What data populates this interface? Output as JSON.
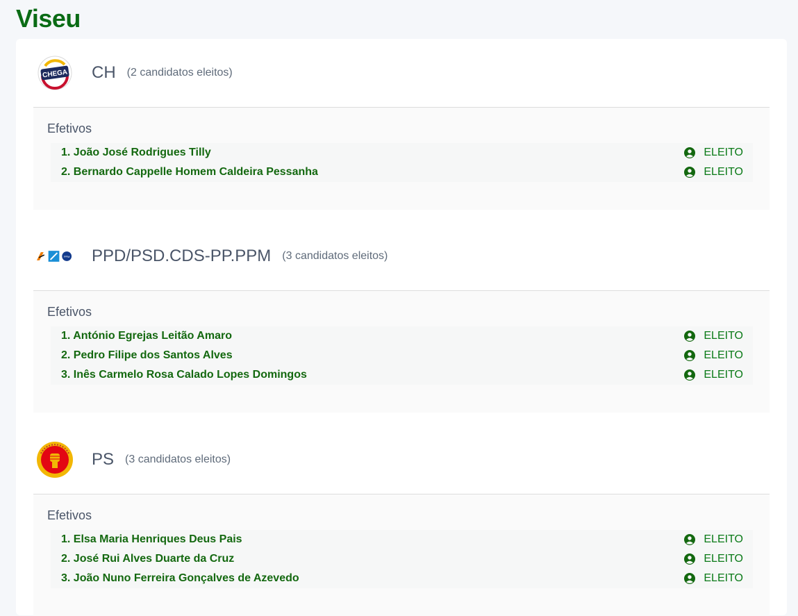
{
  "page_title": "Viseu",
  "parties": [
    {
      "logo_icon": "chega-logo-icon",
      "name": "CH",
      "count": "(2 candidatos eleitos)",
      "section_title": "Efetivos",
      "candidates": [
        {
          "name": "1. João José Rodrigues Tilly",
          "status": "ELEITO"
        },
        {
          "name": "2. Bernardo Cappelle Homem Caldeira Pessanha",
          "status": "ELEITO"
        }
      ]
    },
    {
      "logo_icon": "coalition-logos-icon",
      "name": "PPD/PSD.CDS-PP.PPM",
      "count": "(3 candidatos eleitos)",
      "section_title": "Efetivos",
      "candidates": [
        {
          "name": "1. António Egrejas Leitão Amaro",
          "status": "ELEITO"
        },
        {
          "name": "2. Pedro Filipe dos Santos Alves",
          "status": "ELEITO"
        },
        {
          "name": "3. Inês Carmelo Rosa Calado Lopes Domingos",
          "status": "ELEITO"
        }
      ]
    },
    {
      "logo_icon": "ps-fist-logo-icon",
      "name": "PS",
      "count": "(3 candidatos eleitos)",
      "section_title": "Efetivos",
      "candidates": [
        {
          "name": "1. Elsa Maria Henriques Deus Pais",
          "status": "ELEITO"
        },
        {
          "name": "2. José Rui Alves Duarte da Cruz",
          "status": "ELEITO"
        },
        {
          "name": "3. João Nuno Ferreira Gonçalves de Azevedo",
          "status": "ELEITO"
        }
      ]
    }
  ],
  "colors": {
    "title_green": "#0a6b15",
    "candidate_green": "#13680f",
    "status_green": "#0a7a17"
  }
}
